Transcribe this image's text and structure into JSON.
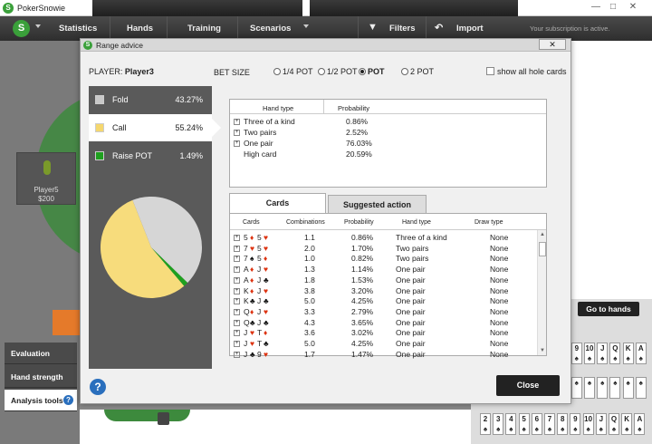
{
  "app": {
    "title": "PokerSnowie"
  },
  "menu": {
    "items": [
      "Statistics",
      "Hands",
      "Training",
      "Scenarios"
    ],
    "filters": "Filters",
    "import": "Import",
    "status": "Your subscription is active."
  },
  "table": {
    "seat_name": "Player5",
    "seat_stack": "$200"
  },
  "left_nav": {
    "items": [
      "Evaluation",
      "Hand strength",
      "Analysis tools"
    ],
    "help": "?"
  },
  "right_panel": {
    "go_to_hands": "Go to hands"
  },
  "dialog": {
    "title": "Range advice",
    "close_x": "✕",
    "player_label": "PLAYER:",
    "player_name": "Player3",
    "bet_size_label": "BET SIZE",
    "bet_options": [
      "1/4 POT",
      "1/2 POT",
      "POT",
      "2 POT"
    ],
    "selected_bet": "POT",
    "show_all": "show all hole cards",
    "actions": [
      {
        "name": "Fold",
        "pct": "43.27%",
        "color": "#c8c8c8"
      },
      {
        "name": "Call",
        "pct": "55.24%",
        "color": "#f5d76e"
      },
      {
        "name": "Raise POT",
        "pct": "1.49%",
        "color": "#1fa01f"
      }
    ],
    "pie": [
      {
        "label": "Fold",
        "value": 43.27,
        "color": "#d6d6d6"
      },
      {
        "label": "Call",
        "value": 55.24,
        "color": "#f7dc7c"
      },
      {
        "label": "Raise POT",
        "value": 1.49,
        "color": "#1fa01f"
      }
    ],
    "hand_type_table": {
      "headers": [
        "Hand type",
        "Probability"
      ],
      "rows": [
        {
          "type": "Three of a kind",
          "prob": "0.86%",
          "expand": true
        },
        {
          "type": "Two pairs",
          "prob": "2.52%",
          "expand": true
        },
        {
          "type": "One pair",
          "prob": "76.03%",
          "expand": true
        },
        {
          "type": "High card",
          "prob": "20.59%",
          "expand": false
        }
      ]
    },
    "tabs": [
      "Cards",
      "Suggested action"
    ],
    "cards_table": {
      "headers": [
        "Cards",
        "Combinations",
        "Probability",
        "Hand type",
        "Draw type"
      ],
      "rows": [
        {
          "c1": "5",
          "s1": "♦",
          "c2": "5",
          "s2": "♥",
          "comb": "1.1",
          "prob": "0.86%",
          "type": "Three of a kind",
          "draw": "None"
        },
        {
          "c1": "7",
          "s1": "♥",
          "c2": "5",
          "s2": "♥",
          "comb": "2.0",
          "prob": "1.70%",
          "type": "Two pairs",
          "draw": "None"
        },
        {
          "c1": "7",
          "s1": "♠",
          "c2": "5",
          "s2": "♦",
          "comb": "1.0",
          "prob": "0.82%",
          "type": "Two pairs",
          "draw": "None"
        },
        {
          "c1": "A",
          "s1": "♦",
          "c2": "J",
          "s2": "♥",
          "comb": "1.3",
          "prob": "1.14%",
          "type": "One pair",
          "draw": "None"
        },
        {
          "c1": "A",
          "s1": "♦",
          "c2": "J",
          "s2": "♣",
          "comb": "1.8",
          "prob": "1.53%",
          "type": "One pair",
          "draw": "None"
        },
        {
          "c1": "K",
          "s1": "♦",
          "c2": "J",
          "s2": "♥",
          "comb": "3.8",
          "prob": "3.20%",
          "type": "One pair",
          "draw": "None"
        },
        {
          "c1": "K",
          "s1": "♣",
          "c2": "J",
          "s2": "♣",
          "comb": "5.0",
          "prob": "4.25%",
          "type": "One pair",
          "draw": "None"
        },
        {
          "c1": "Q",
          "s1": "♦",
          "c2": "J",
          "s2": "♥",
          "comb": "3.3",
          "prob": "2.79%",
          "type": "One pair",
          "draw": "None"
        },
        {
          "c1": "Q",
          "s1": "♣",
          "c2": "J",
          "s2": "♣",
          "comb": "4.3",
          "prob": "3.65%",
          "type": "One pair",
          "draw": "None"
        },
        {
          "c1": "J",
          "s1": "♥",
          "c2": "T",
          "s2": "♦",
          "comb": "3.6",
          "prob": "3.02%",
          "type": "One pair",
          "draw": "None"
        },
        {
          "c1": "J",
          "s1": "♥",
          "c2": "T",
          "s2": "♣",
          "comb": "5.0",
          "prob": "4.25%",
          "type": "One pair",
          "draw": "None"
        },
        {
          "c1": "J",
          "s1": "♣",
          "c2": "9",
          "s2": "♥",
          "comb": "1.7",
          "prob": "1.47%",
          "type": "One pair",
          "draw": "None"
        }
      ]
    },
    "help": "?",
    "close": "Close"
  },
  "card_grid": {
    "rows": [
      {
        "ranks": [
          "9",
          "10",
          "J",
          "Q",
          "K",
          "A"
        ],
        "suit": "♠"
      },
      {
        "ranks": [
          "",
          "",
          "",
          "",
          "",
          ""
        ],
        "suit": "♠"
      },
      {
        "ranks": [
          "2",
          "3",
          "4",
          "5",
          "6",
          "7",
          "8",
          "9",
          "10",
          "J",
          "Q",
          "K",
          "A"
        ],
        "suit": "♠"
      }
    ]
  }
}
